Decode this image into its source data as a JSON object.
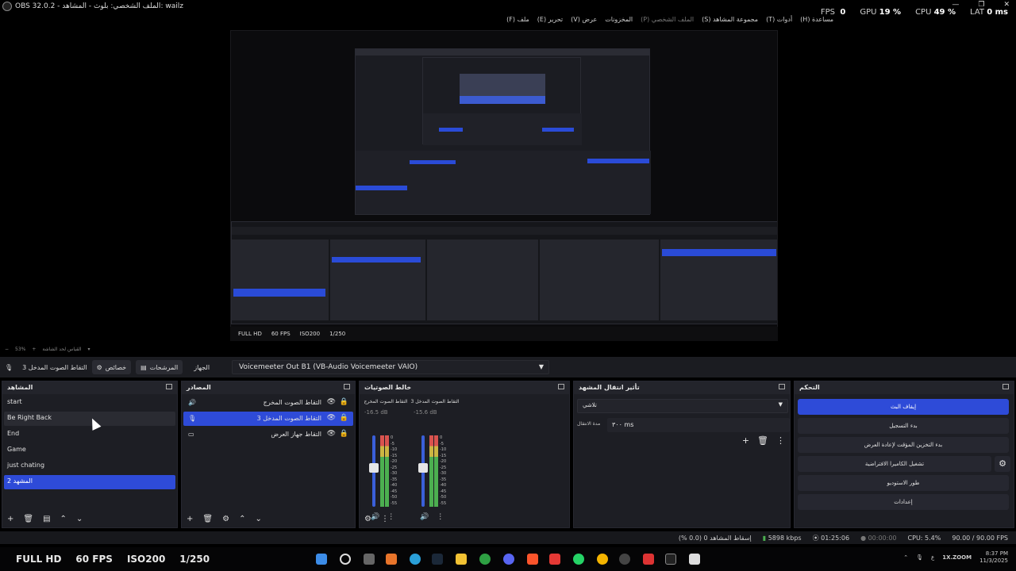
{
  "window": {
    "title": "OBS 32.0.2 - الملف الشخصي: بلوث - المشاهد: wailz",
    "controls": [
      "—",
      "❐",
      "✕"
    ]
  },
  "menubar": {
    "items": [
      "ملف (F)",
      "تحرير (E)",
      "عرض (V)",
      "المخزونات",
      "الملف الشخصي (P)",
      "مجموعة المشاهد (S)",
      "أدوات (T)",
      "مساعدة (H)"
    ]
  },
  "stats": {
    "fps_label": "FPS",
    "fps_value": "0",
    "gpu_label": "GPU",
    "gpu_value": "19 %",
    "cpu_label": "CPU",
    "cpu_value": "49 %",
    "lat_label": "LAT",
    "lat_value": "0 ms"
  },
  "preview_info": {
    "quality": "FULL HD",
    "fps": "60 FPS",
    "iso": "ISO200",
    "shutter": "1/250"
  },
  "zoom": {
    "value": "53%",
    "note": "القياس لحد الشاشة"
  },
  "source_toolbar": {
    "source_name": "التقاط الصوت المدخل 3",
    "properties": "خصائص",
    "filters": "المرشحات",
    "device_label": "الجهاز",
    "device_value": "Voicemeeter Out B1 (VB-Audio Voicemeeter VAIO)"
  },
  "scenes": {
    "title": "المشاهد",
    "items": [
      "start",
      "Be Right Back",
      "End",
      "Game",
      "just chating",
      "المشهد 2"
    ]
  },
  "sources": {
    "title": "المصادر",
    "items": [
      "التقاط الصوت المخرج",
      "التقاط الصوت المدخل 3",
      "التقاط جهاز العرض"
    ]
  },
  "mixer": {
    "title": "خالط الصوتيات",
    "channels": [
      {
        "name": "التقاط الصوت المخرج",
        "db": "-16.5 dB",
        "level": 0.55
      },
      {
        "name": "التقاط الصوت المدخل 3",
        "db": "-15.6 dB",
        "level": 0.55
      }
    ],
    "ticks": [
      "0",
      "-5",
      "-10",
      "-15",
      "-20",
      "-25",
      "-30",
      "-35",
      "-40",
      "-45",
      "-50",
      "-55",
      "-60"
    ]
  },
  "transitions": {
    "title": "تأثير انتقال المشهد",
    "selected": "تلاشي",
    "duration_label": "مدة الانتقال",
    "duration_value": "٣٠٠ ms"
  },
  "controls": {
    "title": "التحكم",
    "buttons": [
      "إيقاف البث",
      "بدء التسجيل",
      "بدء التخزين المؤقت لإعادة العرض",
      "تشغيل الكاميرا الافتراضية",
      "طور الاستوديو",
      "إعدادات"
    ]
  },
  "statusbar": {
    "dropped": "إسقاط المشاهد 0 (0.0 %)",
    "bitrate": "5898 kbps",
    "stream_time": "01:25:06",
    "rec_time": "00:00:00",
    "cpu": "CPU: 5.4%",
    "fps": "90.00 / 90.00 FPS"
  },
  "taskbar": {
    "overlay": [
      "FULL HD",
      "60 FPS",
      "ISO200",
      "1/250"
    ],
    "tray_text": "1X.ZOOM",
    "time": "8:37 PM",
    "date": "11/3/2025",
    "lang": "ع"
  },
  "colors": {
    "accent": "#2e4bd8",
    "bg": "#1d1e24",
    "header": "#23242b"
  }
}
